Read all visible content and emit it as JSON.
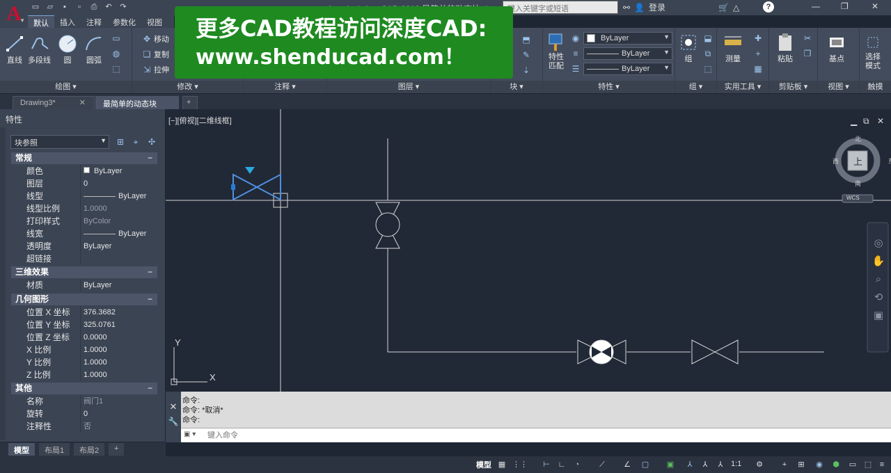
{
  "app": {
    "title": "Autodesk AutoCAD 2018    最简单的动态块.dwg",
    "search_placeholder": "键入关键字或短语",
    "login": "登录"
  },
  "ribbon": {
    "tabs": [
      "默认",
      "插入",
      "注释",
      "参数化",
      "视图"
    ],
    "draw": {
      "title": "绘图",
      "line": "直线",
      "polyline": "多段线",
      "circle": "圆",
      "arc": "圆弧"
    },
    "modify": {
      "title": "修改",
      "move": "移动",
      "copy": "复制",
      "stretch": "拉伸"
    },
    "annotate_title": "注释",
    "layers_title": "图层",
    "block_title": "块",
    "properties": {
      "title": "特性",
      "match": "特性\n匹配",
      "color": "ByLayer",
      "linetype": "ByLayer",
      "lineweight": "ByLayer"
    },
    "groups": {
      "group": "组",
      "group_title": "组"
    },
    "utilities": {
      "measure": "测量",
      "title": "实用工具"
    },
    "clipboard": {
      "paste": "粘贴",
      "title": "剪贴板"
    },
    "view": {
      "base": "基点",
      "title": "视图"
    },
    "touch": {
      "select_mode": "选择\n模式",
      "title": "触摸"
    }
  },
  "banner": {
    "line1": "更多CAD教程访问深度CAD:",
    "line2": "www.shenducad.com！"
  },
  "doc_tabs": {
    "tab1": "Drawing3*",
    "tab2": "最简单的动态块*",
    "add": "+"
  },
  "properties_palette": {
    "title": "特性",
    "selection": "块参照",
    "sections": {
      "general": "常规",
      "effects3d": "三维效果",
      "geometry": "几何图形",
      "misc": "其他"
    },
    "general": [
      {
        "k": "颜色",
        "v": "ByLayer"
      },
      {
        "k": "图层",
        "v": "0"
      },
      {
        "k": "线型",
        "v": "ByLayer"
      },
      {
        "k": "线型比例",
        "v": "1.0000"
      },
      {
        "k": "打印样式",
        "v": "ByColor"
      },
      {
        "k": "线宽",
        "v": "ByLayer"
      },
      {
        "k": "透明度",
        "v": "ByLayer"
      },
      {
        "k": "超链接",
        "v": ""
      }
    ],
    "effects3d": [
      {
        "k": "材质",
        "v": "ByLayer"
      }
    ],
    "geometry": [
      {
        "k": "位置 X 坐标",
        "v": "376.3682"
      },
      {
        "k": "位置 Y 坐标",
        "v": "325.0761"
      },
      {
        "k": "位置 Z 坐标",
        "v": "0.0000"
      },
      {
        "k": "X 比例",
        "v": "1.0000"
      },
      {
        "k": "Y 比例",
        "v": "1.0000"
      },
      {
        "k": "Z 比例",
        "v": "1.0000"
      }
    ],
    "misc": [
      {
        "k": "名称",
        "v": "阀门1"
      },
      {
        "k": "旋转",
        "v": "0"
      },
      {
        "k": "注释性",
        "v": "否"
      }
    ]
  },
  "viewport": {
    "label": "[−][俯视][二维线框]",
    "compass": {
      "north": "北",
      "south": "南",
      "east": "东",
      "west": "西",
      "top": "上",
      "wcs": "WCS"
    },
    "ucs": {
      "x": "X",
      "y": "Y"
    }
  },
  "command": {
    "history": [
      "命令:",
      "命令: *取消*",
      "命令:"
    ],
    "placeholder": "键入命令"
  },
  "layout_tabs": [
    "模型",
    "布局1",
    "布局2",
    "+"
  ],
  "statusbar": {
    "model": "模型",
    "scale": "1:1"
  }
}
